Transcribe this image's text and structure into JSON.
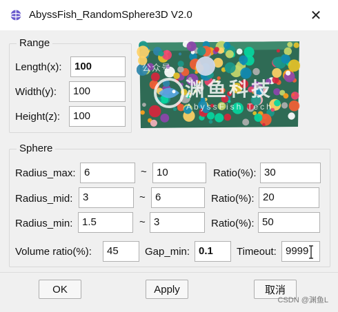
{
  "window": {
    "title": "AbyssFish_RandomSphere3D V2.0",
    "close_glyph": "✕"
  },
  "range": {
    "title": "Range",
    "length_label": "Length(x):",
    "length_value": "100",
    "width_label": "Width(y):",
    "width_value": "100",
    "height_label": "Height(z):",
    "height_value": "100"
  },
  "preview": {
    "watermark_small": "公众号",
    "watermark_big": "渊鱼科技",
    "watermark_sub": "AbyssFish Tech"
  },
  "sphere": {
    "title": "Sphere",
    "tilde": "~",
    "rows": [
      {
        "label": "Radius_max:",
        "min": "6",
        "max": "10",
        "ratio_label": "Ratio(%):",
        "ratio": "30"
      },
      {
        "label": "Radius_mid:",
        "min": "3",
        "max": "6",
        "ratio_label": "Ratio(%):",
        "ratio": "20"
      },
      {
        "label": "Radius_min:",
        "min": "1.5",
        "max": "3",
        "ratio_label": "Ratio(%):",
        "ratio": "50"
      }
    ],
    "volume_label": "Volume ratio(%):",
    "volume_value": "45",
    "gap_label": "Gap_min:",
    "gap_value": "0.1",
    "timeout_label": "Timeout:",
    "timeout_value": "9999"
  },
  "buttons": {
    "ok": "OK",
    "apply": "Apply",
    "cancel": "取消"
  },
  "credit": "CSDN @渊鱼L",
  "colors": {
    "block_green": "#2f6b55",
    "accent": "#3a7bd5"
  }
}
